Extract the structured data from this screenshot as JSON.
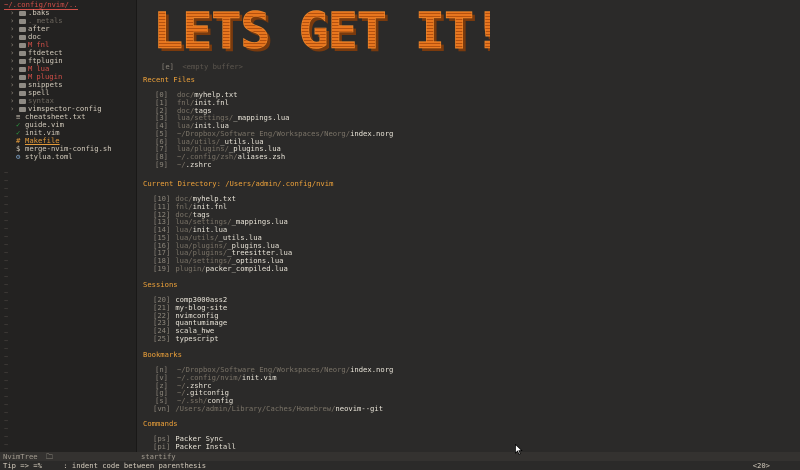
{
  "sidebar": {
    "root_path": "~/.config/nvim/..",
    "items": [
      {
        "arrow": "›",
        "icon": "folder",
        "name": ".baks",
        "color": "#d4ccbd"
      },
      {
        "arrow": "›",
        "icon": "folder",
        "name": "._metals",
        "color": "#6e685f"
      },
      {
        "arrow": "›",
        "icon": "folder",
        "name": "after",
        "color": "#d4ccbd"
      },
      {
        "arrow": "›",
        "icon": "folder",
        "name": "doc",
        "color": "#d4ccbd"
      },
      {
        "arrow": "›",
        "icon": "folder",
        "flag": "M",
        "name": "fnl",
        "color": "#d14f48"
      },
      {
        "arrow": "›",
        "icon": "folder",
        "name": "ftdetect",
        "color": "#d4ccbd"
      },
      {
        "arrow": "›",
        "icon": "folder",
        "name": "ftplugin",
        "color": "#d4ccbd"
      },
      {
        "arrow": "›",
        "icon": "folder",
        "flag": "M",
        "name": "lua",
        "color": "#d14f48"
      },
      {
        "arrow": "›",
        "icon": "folder",
        "flag": "M",
        "name": "plugin",
        "color": "#d14f48"
      },
      {
        "arrow": "›",
        "icon": "folder",
        "name": "snippets",
        "color": "#d4ccbd"
      },
      {
        "arrow": "›",
        "icon": "folder",
        "name": "spell",
        "color": "#d4ccbd"
      },
      {
        "arrow": "›",
        "icon": "folder",
        "name": "syntax",
        "color": "#6e685f"
      },
      {
        "arrow": "›",
        "icon": "folder",
        "name": "vimspector-config",
        "color": "#d4ccbd"
      },
      {
        "arrow": "",
        "icon": "file-md",
        "name": "cheatsheet.txt",
        "color": "#d4ccbd",
        "icon_glyph": "≡",
        "icon_color": "#d4ccbd"
      },
      {
        "arrow": "",
        "icon": "file-vim",
        "name": "guide.vim",
        "color": "#d4ccbd",
        "icon_glyph": "✓",
        "icon_color": "#2c9a41"
      },
      {
        "arrow": "",
        "icon": "file-vim",
        "name": "init.vim",
        "color": "#d4ccbd",
        "icon_glyph": "✓",
        "icon_color": "#2c9a41"
      },
      {
        "arrow": "",
        "icon": "file-make",
        "name": "Makefile",
        "color": "#e39a3a",
        "icon_glyph": "#",
        "icon_color": "#e39a3a",
        "underline": true
      },
      {
        "arrow": "",
        "icon": "file-sh",
        "name": "merge-nvim-config.sh",
        "color": "#d4ccbd",
        "icon_glyph": "$",
        "icon_color": "#d4ccbd"
      },
      {
        "arrow": "",
        "icon": "file-toml",
        "name": "stylua.toml",
        "color": "#d4ccbd",
        "icon_glyph": "⚙",
        "icon_color": "#7da3c9"
      }
    ]
  },
  "startify": {
    "logo_text": "LETS GET IT!",
    "empty_buffer": {
      "key": "[e]",
      "label": "<empty buffer>"
    },
    "sections": [
      {
        "title": "Recent Files",
        "items": [
          {
            "key": "[0]",
            "dir": "doc/",
            "file": "myhelp.txt"
          },
          {
            "key": "[1]",
            "dir": "fnl/",
            "file": "init.fnl"
          },
          {
            "key": "[2]",
            "dir": "doc/",
            "file": "tags"
          },
          {
            "key": "[3]",
            "dir": "lua/settings/",
            "file": "_mappings.lua"
          },
          {
            "key": "[4]",
            "dir": "lua/",
            "file": "init.lua"
          },
          {
            "key": "[5]",
            "dir": "~/Dropbox/Software Eng/Workspaces/Neorg/",
            "file": "index.norg"
          },
          {
            "key": "[6]",
            "dir": "lua/utils/",
            "file": "_utils.lua"
          },
          {
            "key": "[7]",
            "dir": "lua/plugins/",
            "file": "_plugins.lua"
          },
          {
            "key": "[8]",
            "dir": "~/.config/zsh/",
            "file": "aliases.zsh"
          },
          {
            "key": "[9]",
            "dir": "~/",
            "file": ".zshrc"
          }
        ]
      },
      {
        "title": "Current Directory: /Users/admin/.config/nvim",
        "items": [
          {
            "key": "[10]",
            "dir": "doc/",
            "file": "myhelp.txt"
          },
          {
            "key": "[11]",
            "dir": "fnl/",
            "file": "init.fnl"
          },
          {
            "key": "[12]",
            "dir": "doc/",
            "file": "tags"
          },
          {
            "key": "[13]",
            "dir": "lua/settings/",
            "file": "_mappings.lua"
          },
          {
            "key": "[14]",
            "dir": "lua/",
            "file": "init.lua"
          },
          {
            "key": "[15]",
            "dir": "lua/utils/",
            "file": "_utils.lua"
          },
          {
            "key": "[16]",
            "dir": "lua/plugins/",
            "file": "_plugins.lua"
          },
          {
            "key": "[17]",
            "dir": "lua/plugins/",
            "file": "_treesitter.lua"
          },
          {
            "key": "[18]",
            "dir": "lua/settings/",
            "file": "_options.lua"
          },
          {
            "key": "[19]",
            "dir": "plugin/",
            "file": "packer_compiled.lua"
          }
        ]
      },
      {
        "title": "Sessions",
        "items": [
          {
            "key": "[20]",
            "dir": "",
            "file": "comp3000ass2"
          },
          {
            "key": "[21]",
            "dir": "",
            "file": "my-blog-site"
          },
          {
            "key": "[22]",
            "dir": "",
            "file": "nvimconfig"
          },
          {
            "key": "[23]",
            "dir": "",
            "file": "quantumimage"
          },
          {
            "key": "[24]",
            "dir": "",
            "file": "scala_hwe"
          },
          {
            "key": "[25]",
            "dir": "",
            "file": "typescript"
          }
        ]
      },
      {
        "title": "Bookmarks",
        "items": [
          {
            "key": "[n]",
            "dir": "~/Dropbox/Software Eng/Workspaces/Neorg/",
            "file": "index.norg"
          },
          {
            "key": "[v]",
            "dir": "~/.config/nvim/",
            "file": "init.vim"
          },
          {
            "key": "[z]",
            "dir": "~/",
            "file": ".zshrc"
          },
          {
            "key": "[g]",
            "dir": "~/",
            "file": ".gitconfig"
          },
          {
            "key": "[s]",
            "dir": "~/.ssh/",
            "file": "config"
          },
          {
            "key": "[vn]",
            "dir": "/Users/admin/Library/Caches/Homebrew/",
            "file": "neovim--git"
          }
        ]
      },
      {
        "title": "Commands",
        "items": [
          {
            "key": "[ps]",
            "dir": "",
            "file": "Packer Sync"
          },
          {
            "key": "[pi]",
            "dir": "",
            "file": "Packer Install"
          }
        ]
      }
    ]
  },
  "statusbar": {
    "left": "NvimTree",
    "folder_glyph": "🗀",
    "right": "startify"
  },
  "cmdline": {
    "tip_label": "Tip => ",
    "tip_keys": "=%",
    "tip_text": ": indent code between parenthesis",
    "right": "<20>"
  },
  "colors": {
    "accent_orange": "#f0a33a",
    "logo_orange": "#e8761e",
    "background": "#2b2a29",
    "sidebar_bg": "#232221",
    "git_modified": "#d14f48"
  }
}
